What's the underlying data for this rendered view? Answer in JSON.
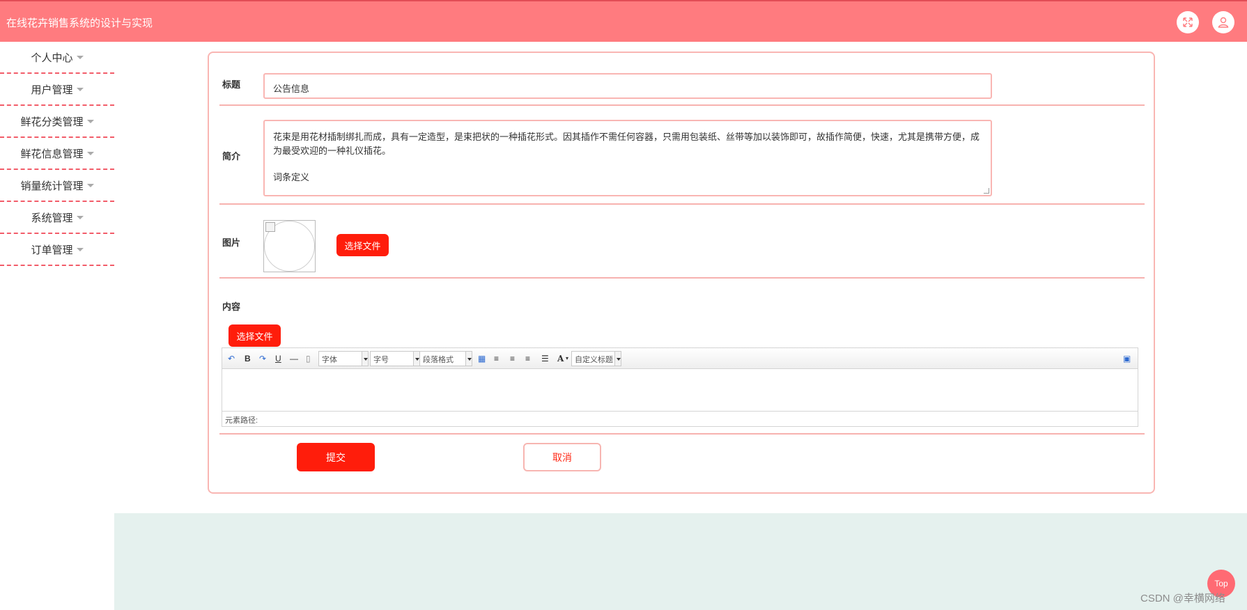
{
  "header": {
    "title": "在线花卉销售系统的设计与实现",
    "fullscreen_icon": "expand-icon",
    "user_icon": "user-icon"
  },
  "sidebar": {
    "items": [
      {
        "label": "个人中心"
      },
      {
        "label": "用户管理"
      },
      {
        "label": "鲜花分类管理"
      },
      {
        "label": "鲜花信息管理"
      },
      {
        "label": "销量统计管理"
      },
      {
        "label": "系统管理"
      },
      {
        "label": "订单管理"
      }
    ]
  },
  "form": {
    "title_label": "标题",
    "title_value": "公告信息",
    "intro_label": "简介",
    "intro_line1": "花束是用花材插制绑扎而成，具有一定造型，是束把状的一种插花形式。因其插作不需任何容器，只需用包装纸、丝带等加以装饰即可，故插作简便，快速，尤其是携带方便，成",
    "intro_line2": "为最受欢迎的一种礼仪插花。",
    "intro_line3": "词条定义",
    "image_label": "图片",
    "choose_file": "选择文件",
    "content_label": "内容",
    "content_choose_file": "选择文件"
  },
  "editor": {
    "toolbar": {
      "undo_icon": "undo-icon",
      "bold": "B",
      "redo_icon": "redo-icon",
      "underline": "U",
      "hr_icon": "horizontal-rule-icon",
      "paste_icon": "paste-icon",
      "font_family": "字体",
      "font_size": "字号",
      "paragraph": "段落格式",
      "table_icon": "table-icon",
      "align_left_icon": "align-left-icon",
      "align_right_icon": "align-right-icon",
      "align_center_icon": "align-center-icon",
      "justify_icon": "justify-icon",
      "font_color": "A",
      "custom_title": "自定义标题",
      "fullscreen_icon": "monitor-icon"
    },
    "element_path": "元素路径:"
  },
  "actions": {
    "submit": "提交",
    "cancel": "取消"
  },
  "misc": {
    "top": "Top",
    "watermark": "CSDN @幸横网络"
  }
}
